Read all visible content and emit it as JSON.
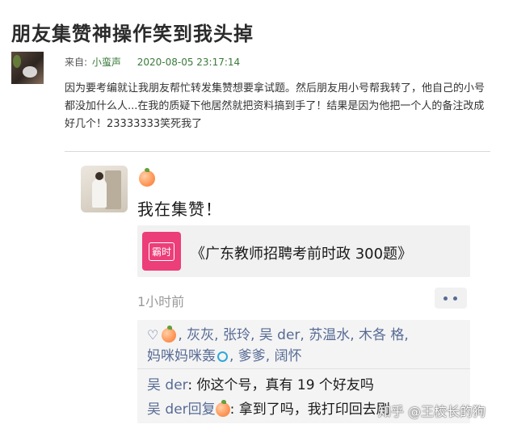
{
  "post": {
    "title": "朋友集赞神操作笑到我头掉",
    "from_label": "来自:",
    "author": "小蛮声",
    "time": "2020-08-05 23:17:14",
    "body": "因为要考编就让我朋友帮忙转发集赞想要拿试题。然后朋友用小号帮我转了，他自己的小号都没加什么人...在我的质疑下他居然就把资料搞到手了！结果是因为他把一个人的备注改成好几个！23333333笑死我了"
  },
  "moment": {
    "text": "我在集赞！",
    "link_logo": "霸时",
    "link_title": "《广东教师招聘考前时政 300题》",
    "time_ago": "1小时前",
    "likes": {
      "names_line1": ", 灰灰, 张玲, 吴 der, 苏温水, 木各 格,",
      "names_line2a": "妈咪妈咪轰",
      "names_line2b": ", 爹爹, 阔怀"
    },
    "comments": [
      {
        "who": "吴 der",
        "text": ": 你这个号，真有 19 个好友吗"
      },
      {
        "who": "吴 der回复",
        "text": ": 拿到了吗，我打印回去刷"
      }
    ]
  },
  "watermark": "知乎 @王校长的狗"
}
